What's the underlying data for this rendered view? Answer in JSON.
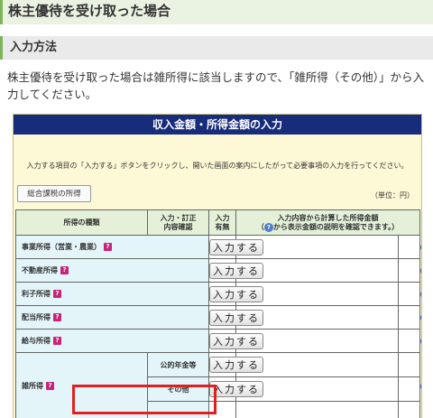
{
  "page_title": "株主優待を受け取った場合",
  "section_heading": "入力方法",
  "intro_text": "株主優待を受け取った場合は雑所得に該当しますので、「雑所得（その他）」から入力してください。",
  "panel": {
    "title": "収入金額・所得金額の入力",
    "instruction": "入力する項目の「入力する」ボタンをクリックし、開いた画面の案内にしたがって必要事項の入力を行ってください。",
    "tab_button": "総合課税の所得",
    "unit": "（単位：円）",
    "headers": {
      "type": "所得の種類",
      "input_line1": "入力・訂正",
      "input_line2": "内容確認",
      "status_line1": "入力",
      "status_line2": "有無",
      "amount_line1": "入力内容から計算した所得金額",
      "amount_line2_pre": "（",
      "amount_line2_post": "から表示金額の説明を確認できます。）"
    },
    "input_button_label": "入力する",
    "rows": [
      {
        "name": "事業所得（営業・農業）"
      },
      {
        "name": "不動産所得"
      },
      {
        "name": "利子所得"
      },
      {
        "name": "配当所得"
      },
      {
        "name": "給与所得"
      }
    ],
    "misc": {
      "name": "雑所得",
      "sub_pension": "公的年金等",
      "sub_other": "その他"
    }
  },
  "icons": {
    "question": "?",
    "help": "?"
  }
}
